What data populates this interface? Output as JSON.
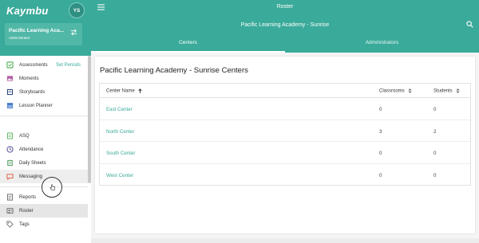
{
  "sidebar": {
    "logo": "Kaymbu",
    "avatar": "YS",
    "school": {
      "name": "Pacific Learning Aca...",
      "role": "Administrator"
    },
    "items": [
      {
        "label": "Assessments",
        "extra": "Set Periods",
        "icon": "assessments-icon"
      },
      {
        "label": "Moments",
        "icon": "moments-icon"
      },
      {
        "label": "Storyboards",
        "icon": "storyboards-icon"
      },
      {
        "label": "Lesson Planner",
        "icon": "lesson-planner-icon"
      },
      {
        "label": "ASQ",
        "icon": "asq-icon"
      },
      {
        "label": "Attendance",
        "icon": "attendance-icon"
      },
      {
        "label": "Daily Sheets",
        "icon": "daily-sheets-icon"
      },
      {
        "label": "Messaging",
        "icon": "messaging-icon"
      },
      {
        "label": "Reports",
        "icon": "reports-icon"
      },
      {
        "label": "Roster",
        "icon": "roster-icon"
      },
      {
        "label": "Tags",
        "icon": "tags-icon"
      }
    ]
  },
  "header": {
    "title": "Roster",
    "subtitle": "Pacific Learning Academy - Sunrise",
    "tabs": [
      {
        "label": "Centers",
        "active": true
      },
      {
        "label": "Administrators",
        "active": false
      }
    ]
  },
  "main": {
    "card_title": "Pacific Learning Academy - Sunrise Centers",
    "columns": [
      "Center Name",
      "Classrooms",
      "Students"
    ],
    "rows": [
      {
        "name": "East Center",
        "classrooms": "0",
        "students": "0"
      },
      {
        "name": "North Center",
        "classrooms": "3",
        "students": "2"
      },
      {
        "name": "South Center",
        "classrooms": "0",
        "students": "0"
      },
      {
        "name": "West Center",
        "classrooms": "0",
        "students": "0"
      }
    ]
  },
  "colors": {
    "accent": "#3aaa9a",
    "accent_dark": "#2f8f82"
  }
}
